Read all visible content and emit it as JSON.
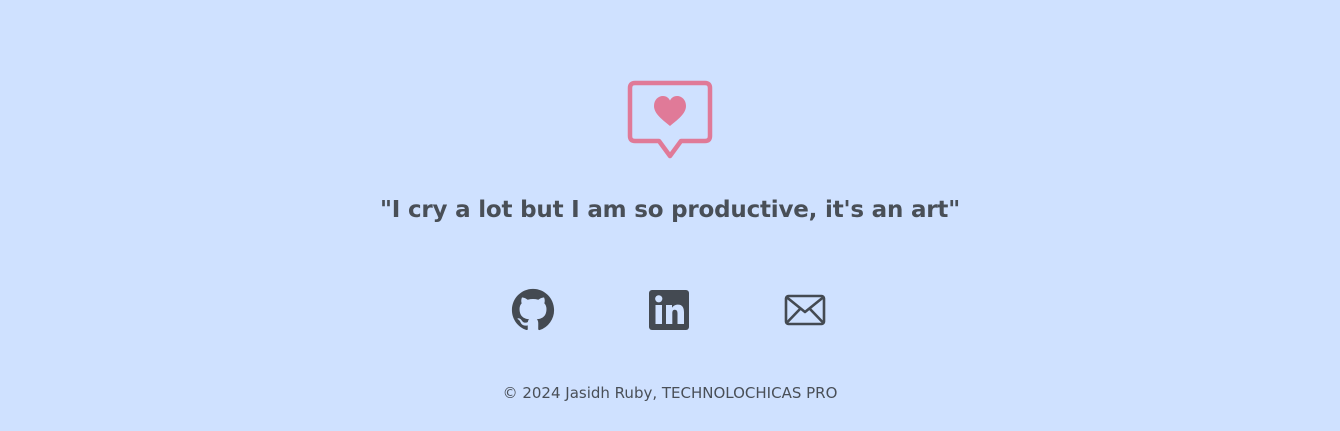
{
  "colors": {
    "background": "#cfe1ff",
    "heart": "#e07a98",
    "text": "#494f57",
    "icon": "#444a52"
  },
  "hero": {
    "icon": "heart-speech-bubble-icon",
    "quote": "\"I cry a lot but I am so productive, it's an art\""
  },
  "socials": [
    {
      "name": "GitHub",
      "icon": "github-icon"
    },
    {
      "name": "LinkedIn",
      "icon": "linkedin-icon"
    },
    {
      "name": "Email",
      "icon": "envelope-icon"
    }
  ],
  "footer": {
    "text": "© 2024 Jasidh Ruby, TECHNOLOCHICAS PRO"
  }
}
